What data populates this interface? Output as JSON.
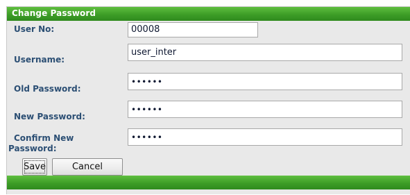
{
  "form": {
    "title": "Change Password",
    "user_no": {
      "label": "User No:",
      "value": "00008"
    },
    "username": {
      "label": "Username:",
      "value": "user_inter"
    },
    "old_password": {
      "label": "Old Password:",
      "value": "••••••"
    },
    "new_password": {
      "label": "New Password:",
      "value": "••••••"
    },
    "confirm_password": {
      "label_line1": "Confirm New",
      "label_line2": "Password:",
      "value": "••••••"
    },
    "save_label": "Save",
    "cancel_label": "Cancel"
  },
  "colors": {
    "header_green": "#3d9d27",
    "label_blue": "#2c4f74",
    "panel_bg": "#e9e9e9"
  }
}
